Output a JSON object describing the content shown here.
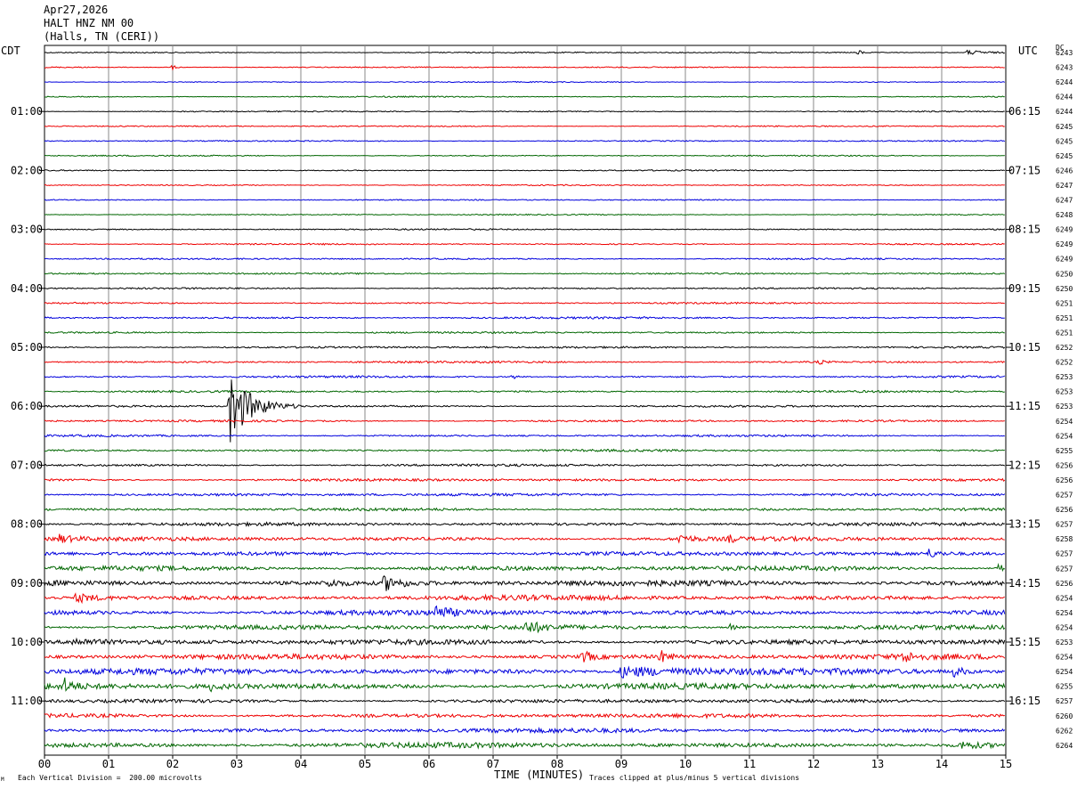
{
  "header": {
    "date": "Apr27,2026",
    "station": "HALT HNZ NM 00",
    "location": "(Halls, TN (CERI))"
  },
  "labels": {
    "left_zone": "CDT",
    "right_zone": "UTC",
    "dc": "DC",
    "xlabel": "TIME (MINUTES)",
    "scale_note": "Each Vertical Division =  200.00 microvolts",
    "clip_note": "Traces clipped at plus/minus 5 vertical divisions",
    "corner_mark": "M"
  },
  "colors": {
    "trace_cycle": [
      "#000000",
      "#ee0000",
      "#0000dd",
      "#006600"
    ],
    "grid": "#888888",
    "grid_blue": "#7777cc"
  },
  "chart_data": {
    "type": "line",
    "trace_count": 48,
    "minutes_per_trace": 15,
    "xlim": [
      0,
      15
    ],
    "x_ticks": [
      "00",
      "01",
      "02",
      "03",
      "04",
      "05",
      "06",
      "07",
      "08",
      "09",
      "10",
      "11",
      "12",
      "13",
      "14",
      "15"
    ],
    "left_hour_labels": [
      {
        "trace": 4,
        "label": "01:00"
      },
      {
        "trace": 8,
        "label": "02:00"
      },
      {
        "trace": 12,
        "label": "03:00"
      },
      {
        "trace": 16,
        "label": "04:00"
      },
      {
        "trace": 20,
        "label": "05:00"
      },
      {
        "trace": 24,
        "label": "06:00"
      },
      {
        "trace": 28,
        "label": "07:00"
      },
      {
        "trace": 32,
        "label": "08:00"
      },
      {
        "trace": 36,
        "label": "09:00"
      },
      {
        "trace": 40,
        "label": "10:00"
      },
      {
        "trace": 44,
        "label": "11:00"
      }
    ],
    "right_hour_labels": [
      {
        "trace": 4,
        "label": "06:15"
      },
      {
        "trace": 8,
        "label": "07:15"
      },
      {
        "trace": 12,
        "label": "08:15"
      },
      {
        "trace": 16,
        "label": "09:15"
      },
      {
        "trace": 20,
        "label": "10:15"
      },
      {
        "trace": 24,
        "label": "11:15"
      },
      {
        "trace": 28,
        "label": "12:15"
      },
      {
        "trace": 32,
        "label": "13:15"
      },
      {
        "trace": 36,
        "label": "14:15"
      },
      {
        "trace": 40,
        "label": "15:15"
      },
      {
        "trace": 44,
        "label": "16:15"
      }
    ],
    "dc_offsets": [
      "6243",
      "6243",
      "6244",
      "6244",
      "6244",
      "6245",
      "6245",
      "6245",
      "6246",
      "6247",
      "6247",
      "6248",
      "6249",
      "6249",
      "6249",
      "6250",
      "6250",
      "6251",
      "6251",
      "6251",
      "6252",
      "6252",
      "6253",
      "6253",
      "6253",
      "6254",
      "6254",
      "6255",
      "6256",
      "6256",
      "6257",
      "6256",
      "6257",
      "6258",
      "6257",
      "6257",
      "6256",
      "6254",
      "6254",
      "6254",
      "6253",
      "6254",
      "6254",
      "6255",
      "6257",
      "6260",
      "6262",
      "6264"
    ],
    "noise_levels": [
      0.6,
      0.6,
      0.5,
      0.6,
      0.6,
      0.6,
      0.6,
      0.6,
      0.6,
      0.6,
      0.6,
      0.6,
      0.7,
      0.7,
      0.8,
      0.8,
      0.8,
      0.8,
      1.0,
      0.9,
      1.0,
      1.0,
      1.0,
      1.0,
      1.0,
      1.0,
      1.0,
      1.1,
      1.2,
      1.3,
      1.4,
      1.4,
      1.6,
      2.0,
      2.0,
      2.4,
      2.8,
      2.6,
      2.6,
      2.4,
      2.6,
      2.6,
      3.0,
      3.0,
      1.8,
      2.0,
      2.2,
      2.6
    ],
    "events": [
      {
        "trace": 0,
        "minute": 12.7,
        "amp": 3,
        "dur": 0.1
      },
      {
        "trace": 0,
        "minute": 14.4,
        "amp": 2.5,
        "dur": 0.6
      },
      {
        "trace": 1,
        "minute": 2.0,
        "amp": 2.5,
        "dur": 0.1
      },
      {
        "trace": 24,
        "minute": 2.9,
        "amp": 40,
        "dur": 0.5
      },
      {
        "trace": 22,
        "minute": 7.3,
        "amp": 3,
        "dur": 0.1
      },
      {
        "trace": 21,
        "minute": 12.1,
        "amp": 3,
        "dur": 0.1
      },
      {
        "trace": 33,
        "minute": 0.2,
        "amp": 5,
        "dur": 0.3
      },
      {
        "trace": 33,
        "minute": 9.9,
        "amp": 5,
        "dur": 0.3
      },
      {
        "trace": 33,
        "minute": 10.7,
        "amp": 5,
        "dur": 0.1
      },
      {
        "trace": 34,
        "minute": 13.8,
        "amp": 4,
        "dur": 0.2
      },
      {
        "trace": 35,
        "minute": 14.9,
        "amp": 6,
        "dur": 0.1
      },
      {
        "trace": 36,
        "minute": 5.3,
        "amp": 8,
        "dur": 0.4
      },
      {
        "trace": 36,
        "minute": 4.4,
        "amp": 4,
        "dur": 0.3
      },
      {
        "trace": 37,
        "minute": 0.5,
        "amp": 5,
        "dur": 0.4
      },
      {
        "trace": 38,
        "minute": 6.1,
        "amp": 8,
        "dur": 0.3
      },
      {
        "trace": 39,
        "minute": 7.5,
        "amp": 7,
        "dur": 0.4
      },
      {
        "trace": 39,
        "minute": 10.7,
        "amp": 5,
        "dur": 0.1
      },
      {
        "trace": 40,
        "minute": 0.4,
        "amp": 4,
        "dur": 0.5
      },
      {
        "trace": 41,
        "minute": 8.4,
        "amp": 7,
        "dur": 0.2
      },
      {
        "trace": 41,
        "minute": 9.6,
        "amp": 7,
        "dur": 0.2
      },
      {
        "trace": 41,
        "minute": 13.4,
        "amp": 6,
        "dur": 0.2
      },
      {
        "trace": 42,
        "minute": 9.0,
        "amp": 6,
        "dur": 1.3
      },
      {
        "trace": 42,
        "minute": 14.2,
        "amp": 6,
        "dur": 0.2
      },
      {
        "trace": 43,
        "minute": 0.3,
        "amp": 8,
        "dur": 0.2
      },
      {
        "trace": 43,
        "minute": 2.6,
        "amp": 4,
        "dur": 0.2
      },
      {
        "trace": 47,
        "minute": 14.3,
        "amp": 4,
        "dur": 0.4
      }
    ]
  }
}
